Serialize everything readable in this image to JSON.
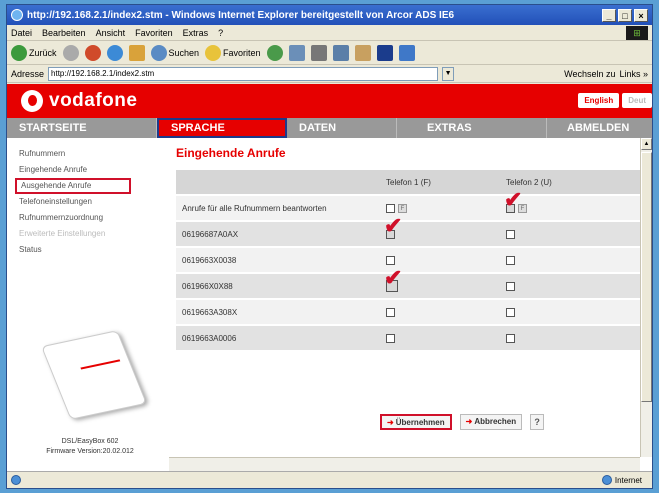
{
  "window": {
    "title": "http://192.168.2.1/index2.stm - Windows Internet Explorer bereitgestellt von Arcor ADS IE6",
    "controls": [
      "_",
      "□",
      "×"
    ]
  },
  "menu": [
    "Datei",
    "Bearbeiten",
    "Ansicht",
    "Favoriten",
    "Extras",
    "?"
  ],
  "toolbar": {
    "back": "Zurück",
    "search": "Suchen",
    "favorites": "Favoriten"
  },
  "address": {
    "label": "Adresse",
    "value": "http://192.168.2.1/index2.stm",
    "go_label": "Wechseln zu",
    "links_label": "Links »"
  },
  "header": {
    "brand": "vodafone",
    "lang_english": "English",
    "lang_deutsch": "Deut"
  },
  "nav": [
    {
      "label": "STARTSEITE",
      "active": false
    },
    {
      "label": "SPRACHE",
      "active": true
    },
    {
      "label": "DATEN",
      "active": false
    },
    {
      "label": "EXTRAS",
      "active": false
    },
    {
      "label": "ABMELDEN",
      "active": false
    }
  ],
  "sidebar": {
    "items": [
      {
        "label": "Rufnummern",
        "state": "normal"
      },
      {
        "label": "Eingehende Anrufe",
        "state": "normal"
      },
      {
        "label": "Ausgehende Anrufe",
        "state": "highlighted"
      },
      {
        "label": "Telefoneinstellungen",
        "state": "normal"
      },
      {
        "label": "Rufnummernzuordnung",
        "state": "normal"
      },
      {
        "label": "Erweiterte Einstellungen",
        "state": "disabled"
      },
      {
        "label": "Status",
        "state": "normal"
      }
    ],
    "device_name": "DSL/EasyBox 602",
    "firmware": "Firmware Version:20.02.012"
  },
  "main": {
    "heading": "Eingehende Anrufe",
    "col_phone1": "Telefon 1 (F)",
    "col_phone2": "Telefon 2 (U)",
    "row_all": "Anrufe für alle Rufnummern beantworten",
    "numbers": [
      "06196687A0AX",
      "0619663X0038",
      "061966X0X88",
      "0619663A308X",
      "0619663A0006"
    ]
  },
  "actions": {
    "apply": "Übernehmen",
    "cancel": "Abbrechen",
    "help": "?"
  },
  "status": {
    "zone": "Internet"
  }
}
